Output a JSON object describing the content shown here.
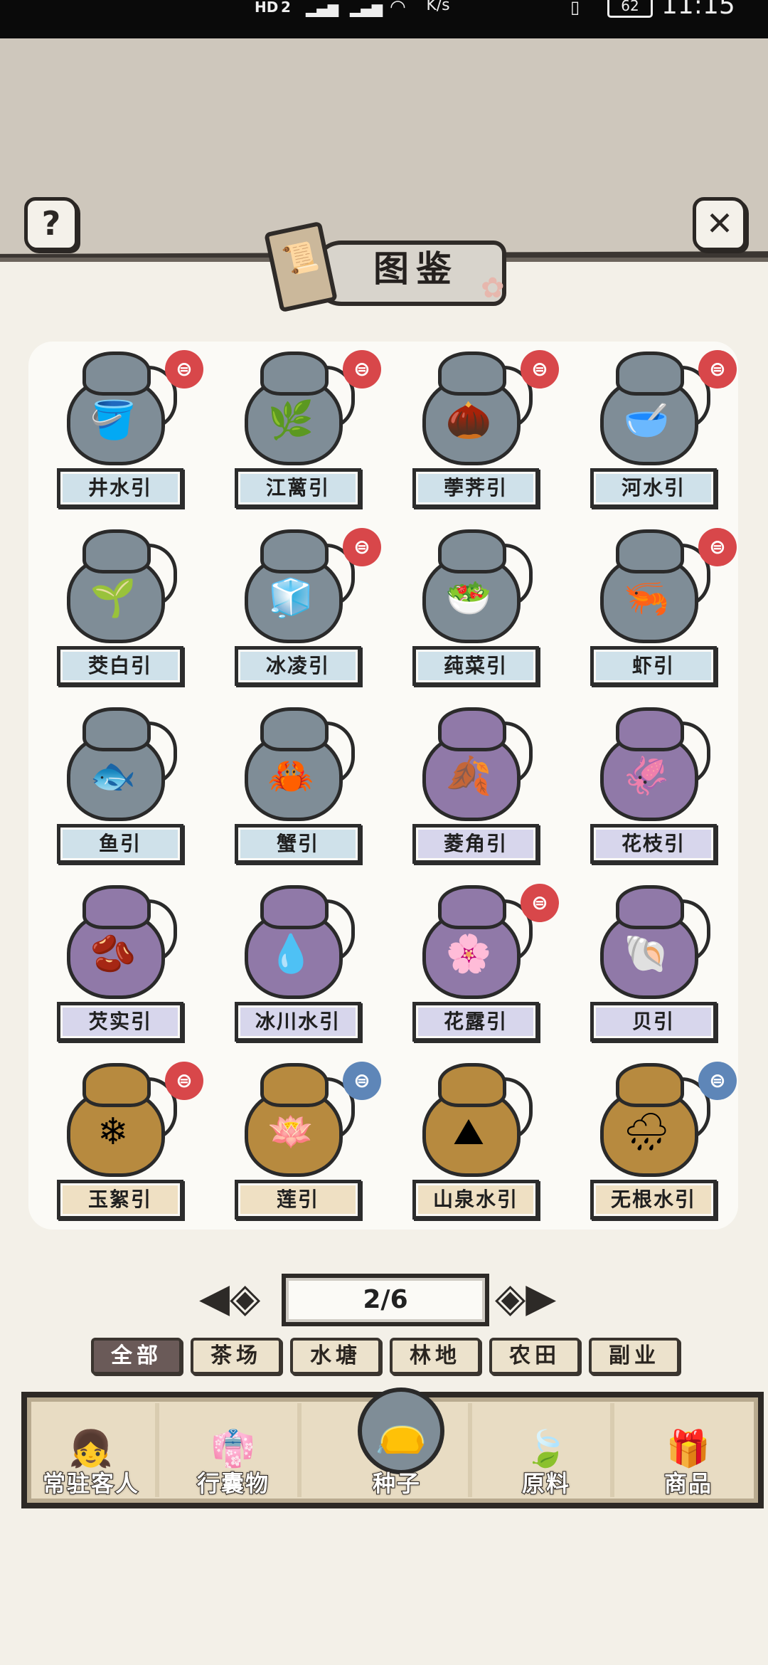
{
  "status_bar": {
    "hd": "HD",
    "sim": "2",
    "speed": "K/s",
    "battery": "62",
    "time": "11:15"
  },
  "header": {
    "title": "图鉴"
  },
  "grid": {
    "rows": [
      [
        {
          "label": "井水引",
          "color": "blue",
          "icon": "🪣",
          "badge": "red"
        },
        {
          "label": "江蓠引",
          "color": "blue",
          "icon": "🌿",
          "badge": "red"
        },
        {
          "label": "荸荠引",
          "color": "blue",
          "icon": "🌰",
          "badge": "red"
        },
        {
          "label": "河水引",
          "color": "blue",
          "icon": "🥣",
          "badge": "red"
        }
      ],
      [
        {
          "label": "茭白引",
          "color": "blue",
          "icon": "🌱",
          "badge": ""
        },
        {
          "label": "冰凌引",
          "color": "blue",
          "icon": "🧊",
          "badge": "red"
        },
        {
          "label": "莼菜引",
          "color": "blue",
          "icon": "🥗",
          "badge": ""
        },
        {
          "label": "虾引",
          "color": "blue",
          "icon": "🦐",
          "badge": "red"
        }
      ],
      [
        {
          "label": "鱼引",
          "color": "blue",
          "icon": "🐟",
          "badge": ""
        },
        {
          "label": "蟹引",
          "color": "blue",
          "icon": "🦀",
          "badge": ""
        },
        {
          "label": "菱角引",
          "color": "purple",
          "icon": "🍂",
          "badge": ""
        },
        {
          "label": "花枝引",
          "color": "purple",
          "icon": "🦑",
          "badge": ""
        }
      ],
      [
        {
          "label": "芡实引",
          "color": "purple",
          "icon": "🫘",
          "badge": ""
        },
        {
          "label": "冰川水引",
          "color": "purple",
          "icon": "💧",
          "badge": ""
        },
        {
          "label": "花露引",
          "color": "purple",
          "icon": "🌸",
          "badge": "red"
        },
        {
          "label": "贝引",
          "color": "purple",
          "icon": "🐚",
          "badge": ""
        }
      ],
      [
        {
          "label": "玉絮引",
          "color": "gold",
          "icon": "❄",
          "badge": "red"
        },
        {
          "label": "莲引",
          "color": "gold",
          "icon": "🪷",
          "badge": "blue"
        },
        {
          "label": "山泉水引",
          "color": "gold",
          "icon": "⛰",
          "badge": ""
        },
        {
          "label": "无根水引",
          "color": "gold",
          "icon": "🌧",
          "badge": "blue"
        }
      ]
    ]
  },
  "pager": {
    "text": "2/6",
    "prev": "◈",
    "next": "◈"
  },
  "tabs": [
    "全部",
    "茶场",
    "水塘",
    "林地",
    "农田",
    "副业"
  ],
  "nav": [
    {
      "label": "常驻客人",
      "icon": "👧"
    },
    {
      "label": "行囊物",
      "icon": "👘"
    },
    {
      "label": "种子",
      "icon": "👝"
    },
    {
      "label": "原料",
      "icon": "🍃"
    },
    {
      "label": "商品",
      "icon": "🎁"
    }
  ],
  "icons": {
    "help": "?",
    "close": "✕",
    "title_scroll": "📜",
    "title_flower": "✿"
  }
}
